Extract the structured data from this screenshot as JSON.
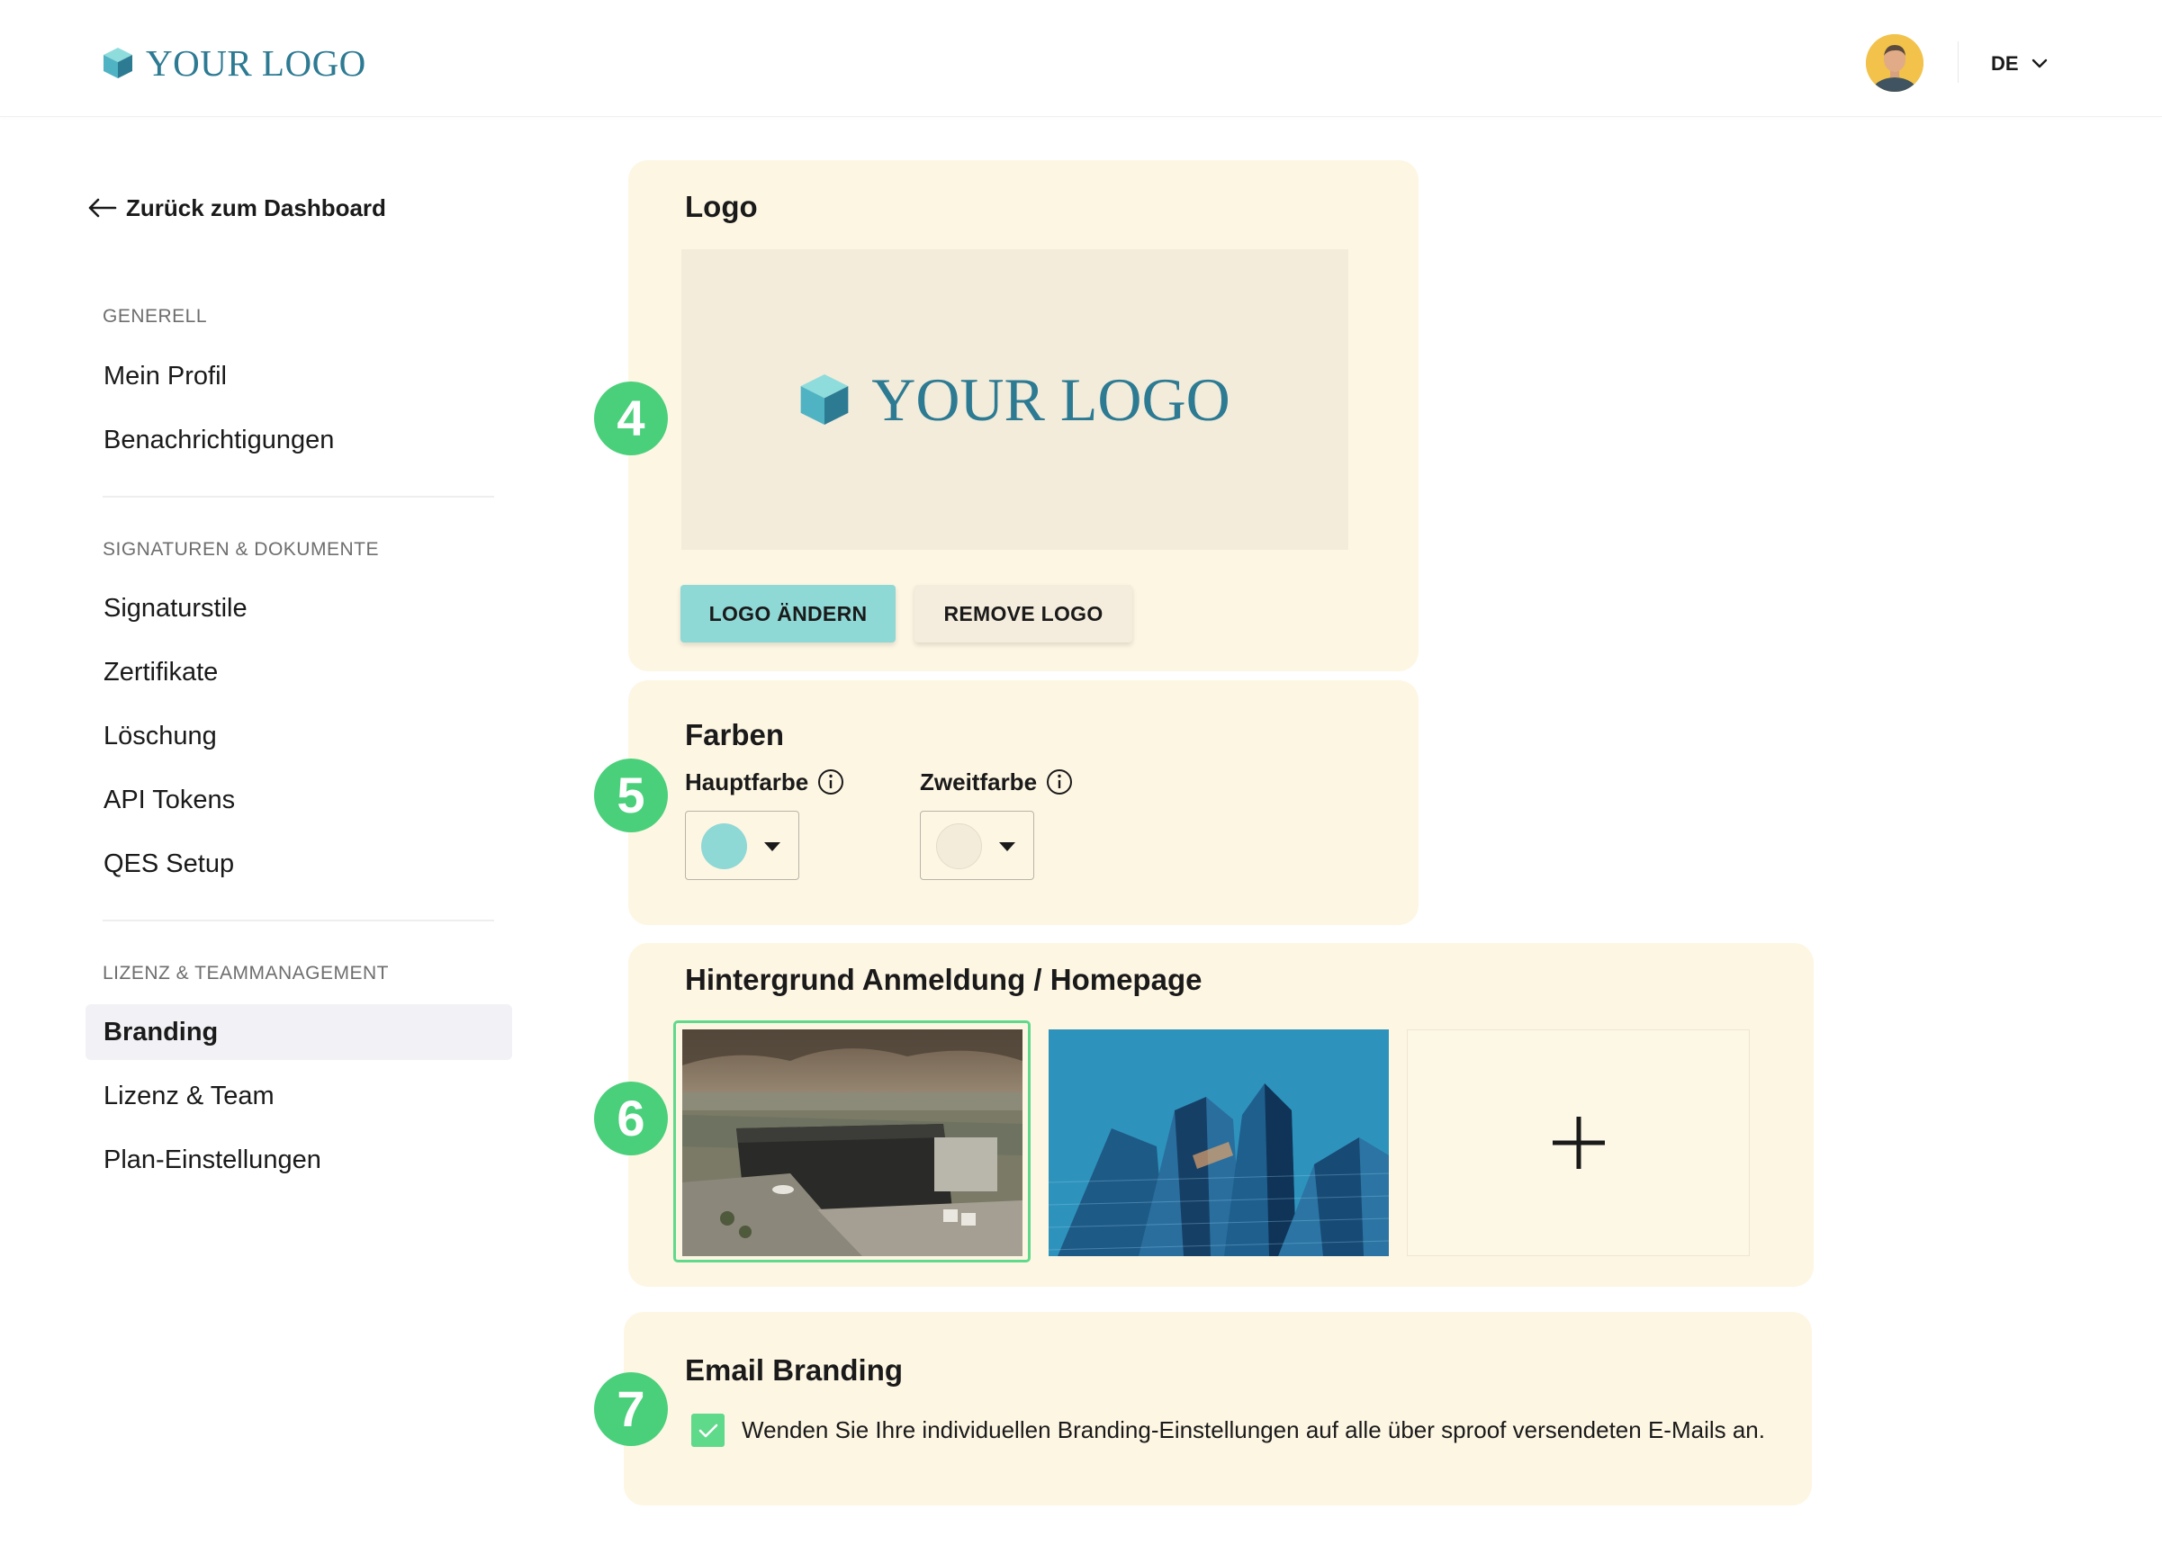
{
  "header": {
    "brand_text": "YOUR LOGO",
    "language": "DE"
  },
  "sidebar": {
    "back_label": "Zurück zum Dashboard",
    "sections": [
      {
        "title": "GENERELL",
        "items": [
          {
            "label": "Mein Profil"
          },
          {
            "label": "Benachrichtigungen"
          }
        ]
      },
      {
        "title": "SIGNATUREN & DOKUMENTE",
        "items": [
          {
            "label": "Signaturstile"
          },
          {
            "label": "Zertifikate"
          },
          {
            "label": "Löschung"
          },
          {
            "label": "API Tokens"
          },
          {
            "label": "QES Setup"
          }
        ]
      },
      {
        "title": "LIZENZ & TEAMMANAGEMENT",
        "items": [
          {
            "label": "Branding",
            "active": true
          },
          {
            "label": "Lizenz & Team"
          },
          {
            "label": "Plan-Einstellungen"
          }
        ]
      }
    ]
  },
  "logo_card": {
    "badge": "4",
    "title": "Logo",
    "preview_text": "YOUR LOGO",
    "change_label": "LOGO ÄNDERN",
    "remove_label": "REMOVE LOGO"
  },
  "colors_card": {
    "badge": "5",
    "title": "Farben",
    "primary_label": "Hauptfarbe",
    "secondary_label": "Zweitfarbe",
    "primary_color": "#8ed8d6",
    "secondary_color": "#f3ecdb"
  },
  "background_card": {
    "badge": "6",
    "title": "Hintergrund Anmeldung / Homepage"
  },
  "email_card": {
    "badge": "7",
    "title": "Email Branding",
    "checkbox_label": "Wenden Sie Ihre individuellen Branding-Einstellungen auf alle über sproof versendeten E-Mails an.",
    "checked": true
  },
  "colors": {
    "brand": "#2d7a93",
    "accent": "#4ad07b",
    "card_bg": "#fdf6e3",
    "primary_button": "#8ed8d6"
  }
}
